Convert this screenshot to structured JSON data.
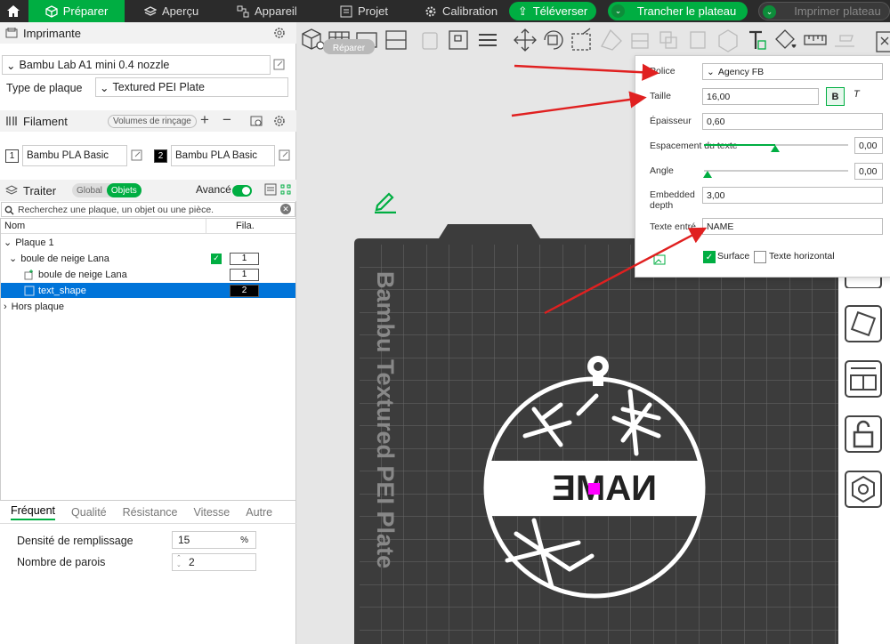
{
  "topbar": {
    "tabs": [
      {
        "label": "Préparer",
        "icon": "cube-icon"
      },
      {
        "label": "Aperçu",
        "icon": "layers-icon"
      },
      {
        "label": "Appareil",
        "icon": "device-icon"
      },
      {
        "label": "Projet",
        "icon": "project-icon"
      },
      {
        "label": "Calibration",
        "icon": "gear-icon"
      }
    ],
    "upload": "Téléverser",
    "slice": "Trancher le plateau",
    "print": "Imprimer plateau"
  },
  "printer": {
    "title": "Imprimante",
    "model": "Bambu Lab A1 mini 0.4 nozzle",
    "plate_type_label": "Type de plaque",
    "plate_type": "Textured PEI Plate"
  },
  "filament": {
    "title": "Filament",
    "purge_button": "Volumes de rinçage",
    "slots": [
      {
        "number": "1",
        "name": "Bambu PLA Basic"
      },
      {
        "number": "2",
        "name": "Bambu PLA Basic"
      }
    ]
  },
  "process": {
    "title": "Traiter",
    "seg_global": "Global",
    "seg_objects": "Objets",
    "advanced": "Avancé",
    "search_placeholder": "Recherchez une plaque, un objet ou une pièce."
  },
  "tree": {
    "col_name": "Nom",
    "col_fila": "Fila.",
    "rows": [
      {
        "label": "Plaque 1",
        "fila": ""
      },
      {
        "label": "boule de neige Lana",
        "fila": "1"
      },
      {
        "label": "boule de neige Lana",
        "fila": "1"
      },
      {
        "label": "text_shape",
        "fila": "2"
      },
      {
        "label": "Hors plaque",
        "fila": ""
      }
    ]
  },
  "settings_tabs": [
    "Fréquent",
    "Qualité",
    "Résistance",
    "Vitesse",
    "Autre"
  ],
  "settings": {
    "infill_label": "Densité de remplissage",
    "infill_value": "15",
    "infill_unit": "%",
    "walls_label": "Nombre de parois",
    "walls_value": "2"
  },
  "popup": {
    "font_label": "Police",
    "font_value": "Agency FB",
    "size_label": "Taille",
    "size_value": "16,00",
    "bold": "B",
    "italic": "T",
    "thickness_label": "Épaisseur",
    "thickness_value": "0,60",
    "spacing_label": "Espacement du texte",
    "spacing_value": "0,00",
    "angle_label": "Angle",
    "angle_value": "0,00",
    "embedded_label": "Embedded\ndepth",
    "embedded_value": "3,00",
    "text_label": "Texte entré",
    "text_value": "NAME",
    "surface_label": "Surface",
    "horizontal_label": "Texte horizontal"
  },
  "viewport": {
    "plate_label": "Bambu Textured PEI Plate",
    "ornament_text": "NAME",
    "tooltip_word": "Réparer"
  },
  "colors": {
    "accent": "#00ae42",
    "selection": "#0074d9",
    "arrow": "#e02020",
    "plate": "#3c3c3c"
  }
}
